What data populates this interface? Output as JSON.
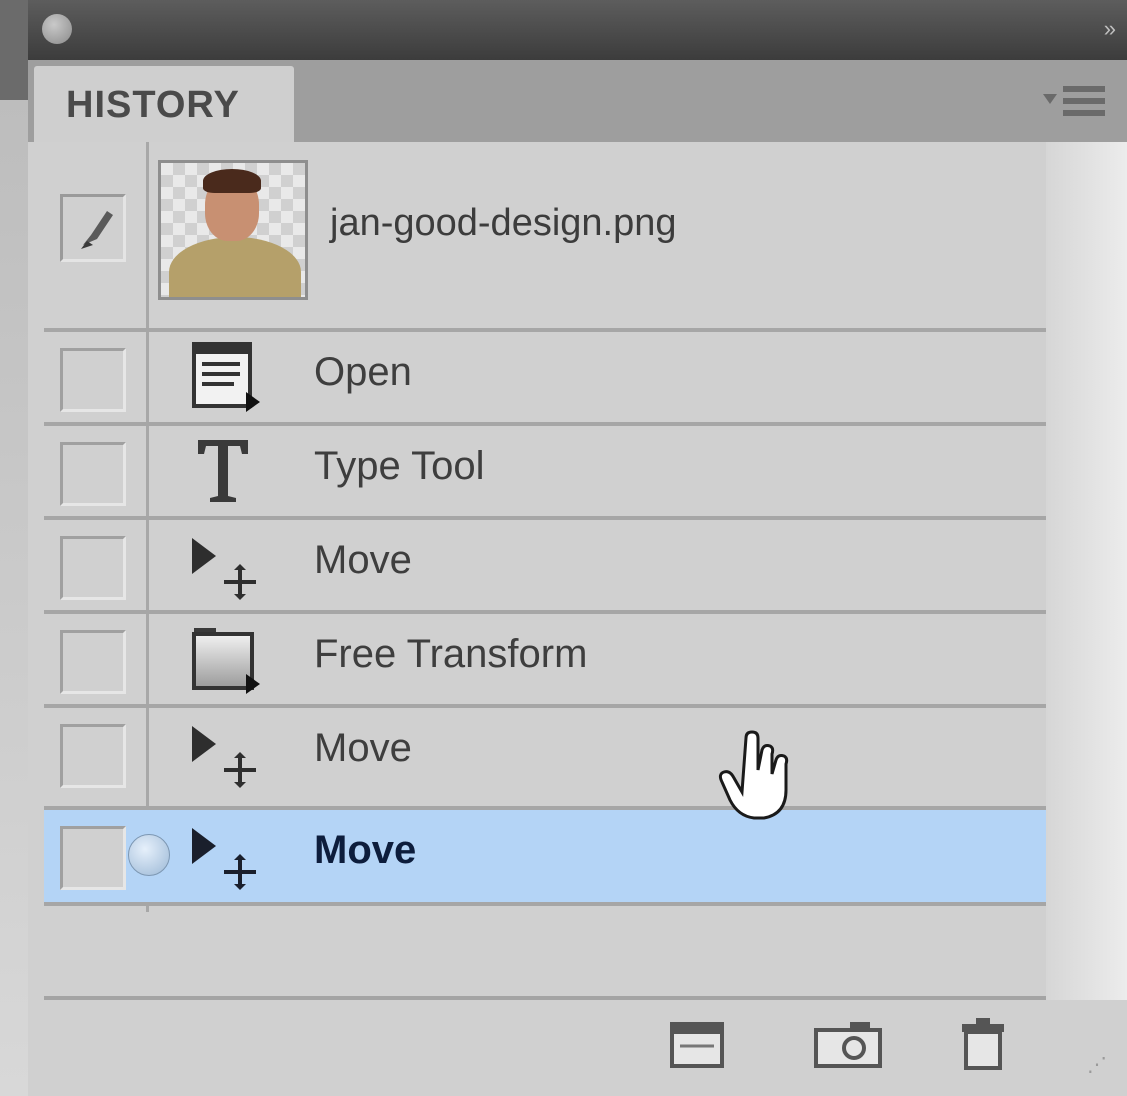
{
  "panel": {
    "tab_label": "HISTORY",
    "collapse_glyph": "»"
  },
  "snapshot": {
    "name": "jan-good-design.png"
  },
  "history": [
    {
      "label": "Open",
      "icon": "open-document-icon"
    },
    {
      "label": "Type Tool",
      "icon": "type-tool-icon"
    },
    {
      "label": "Move",
      "icon": "move-tool-icon"
    },
    {
      "label": "Free Transform",
      "icon": "free-transform-icon"
    },
    {
      "label": "Move",
      "icon": "move-tool-icon"
    },
    {
      "label": "Move",
      "icon": "move-tool-icon",
      "selected": true
    }
  ],
  "footer": {
    "buttons": [
      "new-document-from-state-icon",
      "create-snapshot-icon",
      "delete-state-icon"
    ]
  },
  "colors": {
    "selected_row": "#b4d4f6",
    "panel_bg": "#d0d0d0",
    "titlebar": "#3c3c3c"
  }
}
